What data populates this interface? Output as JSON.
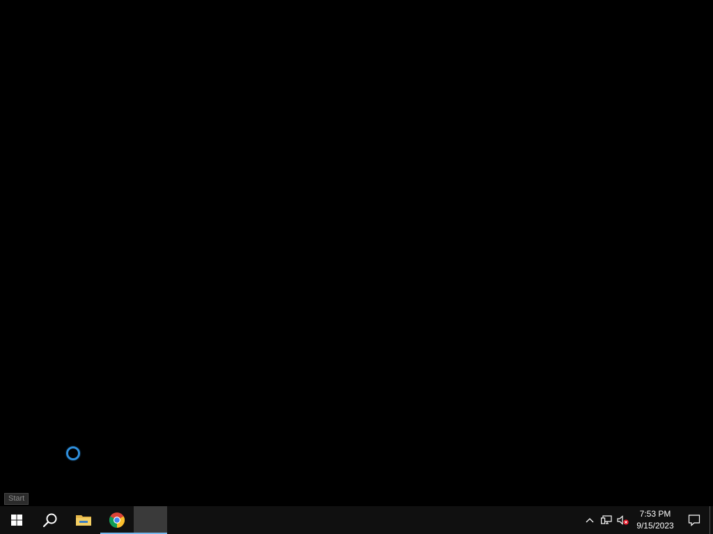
{
  "desktop": {
    "background_color": "#000000",
    "cursor_state": "busy"
  },
  "tooltip": {
    "text": "Start"
  },
  "taskbar": {
    "background_color": "#101010",
    "accent_color": "#76b9ed",
    "buttons": [
      {
        "name": "start",
        "icon": "windows-logo-icon"
      },
      {
        "name": "search",
        "icon": "search-icon"
      },
      {
        "name": "file-explorer",
        "icon": "folder-icon",
        "running": false
      },
      {
        "name": "chrome",
        "icon": "chrome-icon",
        "running": true
      },
      {
        "name": "active-window",
        "icon": "blank-window",
        "running": true,
        "active": true
      }
    ],
    "tray": {
      "icons": [
        "chevron-up-icon",
        "network-icon",
        "volume-muted-icon"
      ],
      "time": "7:53 PM",
      "date": "9/15/2023",
      "notification_icon": "action-center-icon"
    }
  }
}
